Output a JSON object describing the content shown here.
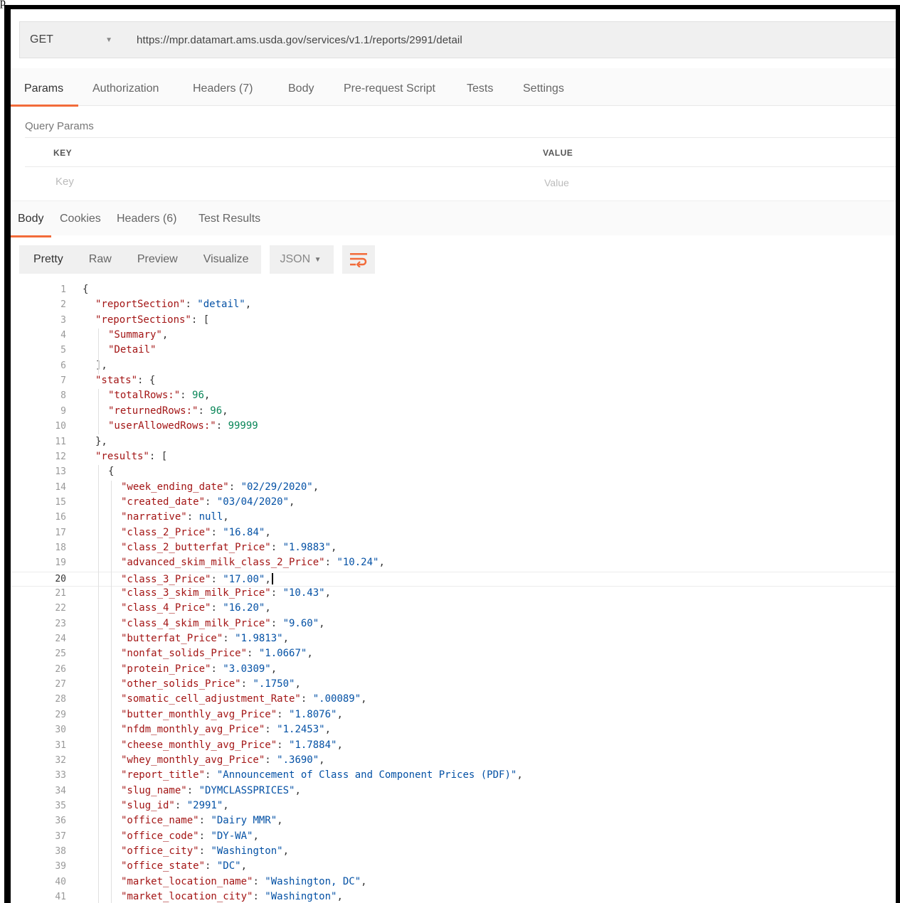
{
  "caption": "p",
  "request": {
    "method": "GET",
    "url": "https://mpr.datamart.ams.usda.gov/services/v1.1/reports/2991/detail"
  },
  "request_tabs": [
    "Params",
    "Authorization",
    "Headers (7)",
    "Body",
    "Pre-request Script",
    "Tests",
    "Settings"
  ],
  "query_params": {
    "title": "Query Params",
    "key_header": "KEY",
    "value_header": "VALUE",
    "key_placeholder": "Key",
    "value_placeholder": "Value"
  },
  "response_tabs": [
    "Body",
    "Cookies",
    "Headers (6)",
    "Test Results"
  ],
  "view_modes": [
    "Pretty",
    "Raw",
    "Preview",
    "Visualize"
  ],
  "format_select": "JSON",
  "icons": {
    "method_dropdown": "chevron-down-icon",
    "format_dropdown": "chevron-down-icon",
    "wrap": "wrap-lines-icon"
  },
  "accent_color": "#f26b3a",
  "current_line": 20,
  "code_lines": [
    {
      "n": 1,
      "i": 0,
      "t": [
        [
          "p",
          "{"
        ]
      ]
    },
    {
      "n": 2,
      "i": 1,
      "t": [
        [
          "k",
          "\"reportSection\""
        ],
        [
          "p",
          ": "
        ],
        [
          "s",
          "\"detail\""
        ],
        [
          "p",
          ","
        ]
      ]
    },
    {
      "n": 3,
      "i": 1,
      "t": [
        [
          "k",
          "\"reportSections\""
        ],
        [
          "p",
          ": ["
        ]
      ]
    },
    {
      "n": 4,
      "i": 2,
      "t": [
        [
          "k",
          "\"Summary\""
        ],
        [
          "p",
          ","
        ]
      ]
    },
    {
      "n": 5,
      "i": 2,
      "t": [
        [
          "k",
          "\"Detail\""
        ]
      ]
    },
    {
      "n": 6,
      "i": 1,
      "t": [
        [
          "p",
          "],"
        ]
      ]
    },
    {
      "n": 7,
      "i": 1,
      "t": [
        [
          "k",
          "\"stats\""
        ],
        [
          "p",
          ": {"
        ]
      ]
    },
    {
      "n": 8,
      "i": 2,
      "t": [
        [
          "k",
          "\"totalRows:\""
        ],
        [
          "p",
          ": "
        ],
        [
          "n",
          "96"
        ],
        [
          "p",
          ","
        ]
      ]
    },
    {
      "n": 9,
      "i": 2,
      "t": [
        [
          "k",
          "\"returnedRows:\""
        ],
        [
          "p",
          ": "
        ],
        [
          "n",
          "96"
        ],
        [
          "p",
          ","
        ]
      ]
    },
    {
      "n": 10,
      "i": 2,
      "t": [
        [
          "k",
          "\"userAllowedRows:\""
        ],
        [
          "p",
          ": "
        ],
        [
          "n",
          "99999"
        ]
      ]
    },
    {
      "n": 11,
      "i": 1,
      "t": [
        [
          "p",
          "},"
        ]
      ]
    },
    {
      "n": 12,
      "i": 1,
      "t": [
        [
          "k",
          "\"results\""
        ],
        [
          "p",
          ": ["
        ]
      ]
    },
    {
      "n": 13,
      "i": 2,
      "t": [
        [
          "p",
          "{"
        ]
      ]
    },
    {
      "n": 14,
      "i": 3,
      "t": [
        [
          "k",
          "\"week_ending_date\""
        ],
        [
          "p",
          ": "
        ],
        [
          "s",
          "\"02/29/2020\""
        ],
        [
          "p",
          ","
        ]
      ]
    },
    {
      "n": 15,
      "i": 3,
      "t": [
        [
          "k",
          "\"created_date\""
        ],
        [
          "p",
          ": "
        ],
        [
          "s",
          "\"03/04/2020\""
        ],
        [
          "p",
          ","
        ]
      ]
    },
    {
      "n": 16,
      "i": 3,
      "t": [
        [
          "k",
          "\"narrative\""
        ],
        [
          "p",
          ": "
        ],
        [
          "nl",
          "null"
        ],
        [
          "p",
          ","
        ]
      ]
    },
    {
      "n": 17,
      "i": 3,
      "t": [
        [
          "k",
          "\"class_2_Price\""
        ],
        [
          "p",
          ": "
        ],
        [
          "s",
          "\"16.84\""
        ],
        [
          "p",
          ","
        ]
      ]
    },
    {
      "n": 18,
      "i": 3,
      "t": [
        [
          "k",
          "\"class_2_butterfat_Price\""
        ],
        [
          "p",
          ": "
        ],
        [
          "s",
          "\"1.9883\""
        ],
        [
          "p",
          ","
        ]
      ]
    },
    {
      "n": 19,
      "i": 3,
      "t": [
        [
          "k",
          "\"advanced_skim_milk_class_2_Price\""
        ],
        [
          "p",
          ": "
        ],
        [
          "s",
          "\"10.24\""
        ],
        [
          "p",
          ","
        ]
      ]
    },
    {
      "n": 20,
      "i": 3,
      "t": [
        [
          "k",
          "\"class_3_Price\""
        ],
        [
          "p",
          ": "
        ],
        [
          "s",
          "\"17.00\""
        ],
        [
          "p",
          ","
        ]
      ]
    },
    {
      "n": 21,
      "i": 3,
      "t": [
        [
          "k",
          "\"class_3_skim_milk_Price\""
        ],
        [
          "p",
          ": "
        ],
        [
          "s",
          "\"10.43\""
        ],
        [
          "p",
          ","
        ]
      ]
    },
    {
      "n": 22,
      "i": 3,
      "t": [
        [
          "k",
          "\"class_4_Price\""
        ],
        [
          "p",
          ": "
        ],
        [
          "s",
          "\"16.20\""
        ],
        [
          "p",
          ","
        ]
      ]
    },
    {
      "n": 23,
      "i": 3,
      "t": [
        [
          "k",
          "\"class_4_skim_milk_Price\""
        ],
        [
          "p",
          ": "
        ],
        [
          "s",
          "\"9.60\""
        ],
        [
          "p",
          ","
        ]
      ]
    },
    {
      "n": 24,
      "i": 3,
      "t": [
        [
          "k",
          "\"butterfat_Price\""
        ],
        [
          "p",
          ": "
        ],
        [
          "s",
          "\"1.9813\""
        ],
        [
          "p",
          ","
        ]
      ]
    },
    {
      "n": 25,
      "i": 3,
      "t": [
        [
          "k",
          "\"nonfat_solids_Price\""
        ],
        [
          "p",
          ": "
        ],
        [
          "s",
          "\"1.0667\""
        ],
        [
          "p",
          ","
        ]
      ]
    },
    {
      "n": 26,
      "i": 3,
      "t": [
        [
          "k",
          "\"protein_Price\""
        ],
        [
          "p",
          ": "
        ],
        [
          "s",
          "\"3.0309\""
        ],
        [
          "p",
          ","
        ]
      ]
    },
    {
      "n": 27,
      "i": 3,
      "t": [
        [
          "k",
          "\"other_solids_Price\""
        ],
        [
          "p",
          ": "
        ],
        [
          "s",
          "\".1750\""
        ],
        [
          "p",
          ","
        ]
      ]
    },
    {
      "n": 28,
      "i": 3,
      "t": [
        [
          "k",
          "\"somatic_cell_adjustment_Rate\""
        ],
        [
          "p",
          ": "
        ],
        [
          "s",
          "\".00089\""
        ],
        [
          "p",
          ","
        ]
      ]
    },
    {
      "n": 29,
      "i": 3,
      "t": [
        [
          "k",
          "\"butter_monthly_avg_Price\""
        ],
        [
          "p",
          ": "
        ],
        [
          "s",
          "\"1.8076\""
        ],
        [
          "p",
          ","
        ]
      ]
    },
    {
      "n": 30,
      "i": 3,
      "t": [
        [
          "k",
          "\"nfdm_monthly_avg_Price\""
        ],
        [
          "p",
          ": "
        ],
        [
          "s",
          "\"1.2453\""
        ],
        [
          "p",
          ","
        ]
      ]
    },
    {
      "n": 31,
      "i": 3,
      "t": [
        [
          "k",
          "\"cheese_monthly_avg_Price\""
        ],
        [
          "p",
          ": "
        ],
        [
          "s",
          "\"1.7884\""
        ],
        [
          "p",
          ","
        ]
      ]
    },
    {
      "n": 32,
      "i": 3,
      "t": [
        [
          "k",
          "\"whey_monthly_avg_Price\""
        ],
        [
          "p",
          ": "
        ],
        [
          "s",
          "\".3690\""
        ],
        [
          "p",
          ","
        ]
      ]
    },
    {
      "n": 33,
      "i": 3,
      "t": [
        [
          "k",
          "\"report_title\""
        ],
        [
          "p",
          ": "
        ],
        [
          "s",
          "\"Announcement of Class and Component Prices (PDF)\""
        ],
        [
          "p",
          ","
        ]
      ]
    },
    {
      "n": 34,
      "i": 3,
      "t": [
        [
          "k",
          "\"slug_name\""
        ],
        [
          "p",
          ": "
        ],
        [
          "s",
          "\"DYMCLASSPRICES\""
        ],
        [
          "p",
          ","
        ]
      ]
    },
    {
      "n": 35,
      "i": 3,
      "t": [
        [
          "k",
          "\"slug_id\""
        ],
        [
          "p",
          ": "
        ],
        [
          "s",
          "\"2991\""
        ],
        [
          "p",
          ","
        ]
      ]
    },
    {
      "n": 36,
      "i": 3,
      "t": [
        [
          "k",
          "\"office_name\""
        ],
        [
          "p",
          ": "
        ],
        [
          "s",
          "\"Dairy MMR\""
        ],
        [
          "p",
          ","
        ]
      ]
    },
    {
      "n": 37,
      "i": 3,
      "t": [
        [
          "k",
          "\"office_code\""
        ],
        [
          "p",
          ": "
        ],
        [
          "s",
          "\"DY-WA\""
        ],
        [
          "p",
          ","
        ]
      ]
    },
    {
      "n": 38,
      "i": 3,
      "t": [
        [
          "k",
          "\"office_city\""
        ],
        [
          "p",
          ": "
        ],
        [
          "s",
          "\"Washington\""
        ],
        [
          "p",
          ","
        ]
      ]
    },
    {
      "n": 39,
      "i": 3,
      "t": [
        [
          "k",
          "\"office_state\""
        ],
        [
          "p",
          ": "
        ],
        [
          "s",
          "\"DC\""
        ],
        [
          "p",
          ","
        ]
      ]
    },
    {
      "n": 40,
      "i": 3,
      "t": [
        [
          "k",
          "\"market_location_name\""
        ],
        [
          "p",
          ": "
        ],
        [
          "s",
          "\"Washington, DC\""
        ],
        [
          "p",
          ","
        ]
      ]
    },
    {
      "n": 41,
      "i": 3,
      "t": [
        [
          "k",
          "\"market_location_city\""
        ],
        [
          "p",
          ": "
        ],
        [
          "s",
          "\"Washington\""
        ],
        [
          "p",
          ","
        ]
      ]
    }
  ]
}
